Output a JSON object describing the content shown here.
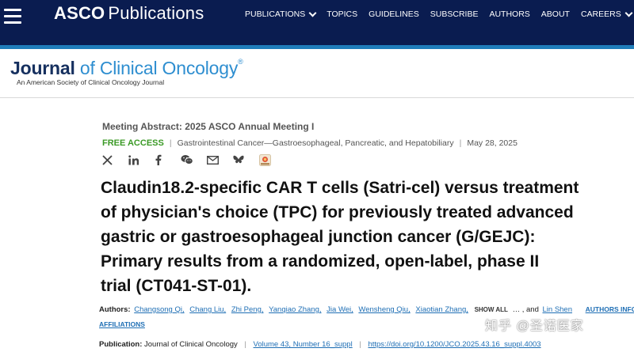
{
  "topbar": {
    "brand_bold": "ASCO",
    "brand_rest": "Publications",
    "nav": [
      {
        "label": "PUBLICATIONS",
        "has_dropdown": true
      },
      {
        "label": "TOPICS",
        "has_dropdown": false
      },
      {
        "label": "GUIDELINES",
        "has_dropdown": false
      },
      {
        "label": "SUBSCRIBE",
        "has_dropdown": false
      },
      {
        "label": "AUTHORS",
        "has_dropdown": false
      },
      {
        "label": "ABOUT",
        "has_dropdown": false
      },
      {
        "label": "CAREERS",
        "has_dropdown": true
      }
    ]
  },
  "journal": {
    "title_part1": "Journal",
    "title_part2": " of Clinical Oncology",
    "reg_mark": "®",
    "subtitle": "An American Society of Clinical Oncology Journal"
  },
  "article": {
    "meeting": "Meeting Abstract: 2025 ASCO Annual Meeting I",
    "access": "FREE ACCESS",
    "category": "Gastrointestinal Cancer—Gastroesophageal, Pancreatic, and Hepatobiliary",
    "date": "May 28, 2025",
    "share_icons": [
      "x-icon",
      "linkedin-icon",
      "facebook-icon",
      "wechat-icon",
      "email-icon",
      "bluesky-icon",
      "altmetric-icon"
    ],
    "title_lines": [
      "Claudin18.2-specific CAR T cells (Satri-cel) versus treatment",
      "of physician's choice (TPC) for previously treated advanced",
      "gastric or gastroesophageal junction cancer (G/GEJC):",
      "Primary results from a randomized, open-label, phase II",
      "trial (CT041-ST-01)."
    ],
    "authors_label": "Authors:",
    "authors": [
      "Changsong Qi,",
      "Chang Liu,",
      "Zhi Peng,",
      "Yanqiao Zhang,",
      "Jia Wei,",
      "Wensheng Qiu,",
      "Xiaotian Zhang,"
    ],
    "show_all": "SHOW ALL",
    "ellipsis": "… , and",
    "last_author": "Lin Shen",
    "authors_info": "AUTHORS INFO &",
    "affiliations": "AFFILIATIONS",
    "publication_label": "Publication:",
    "publication_journal": "Journal of Clinical Oncology",
    "volume": "Volume 43, Number 16_suppl",
    "doi": "https://doi.org/10.1200/JCO.2025.43.16_suppl.4003"
  },
  "watermark": "知乎 @圣诺医家",
  "colors": {
    "navy": "#0a1c50",
    "accent": "#1f7dba",
    "link": "#1f6fb5",
    "free_access": "#3b9a26"
  }
}
